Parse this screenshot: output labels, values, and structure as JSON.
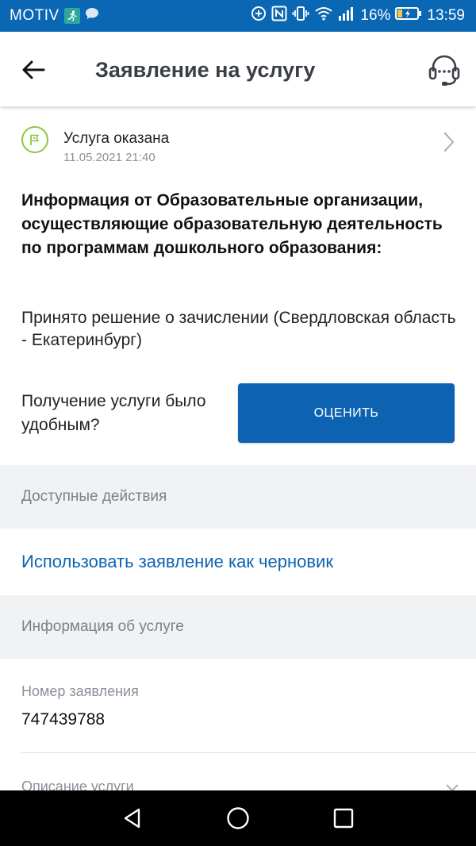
{
  "status_bar": {
    "carrier": "MOTIV",
    "battery_percent": "16%",
    "time": "13:59"
  },
  "app_bar": {
    "title": "Заявление на услугу"
  },
  "status": {
    "title": "Услуга оказана",
    "date": "11.05.2021 21:40"
  },
  "info": {
    "heading": "Информация от Образовательные организации, осуществляющие образовательную деятельность по программам дошкольного образования:",
    "text": "Принято решение о зачислении (Свердловская область - Екатеринбург)"
  },
  "rating": {
    "question": "Получение услуги было удобным?",
    "button_label": "ОЦЕНИТЬ"
  },
  "actions": {
    "header": "Доступные действия",
    "draft_link": "Использовать заявление как черновик"
  },
  "service_info": {
    "header": "Информация об услуге",
    "number_label": "Номер заявления",
    "number_value": "747439788",
    "description_label": "Описание услуги"
  },
  "colors": {
    "primary": "#0d63b2",
    "status_bar": "#0a67b4",
    "success": "#8cc63f",
    "section_bg": "#f1f2f4"
  }
}
